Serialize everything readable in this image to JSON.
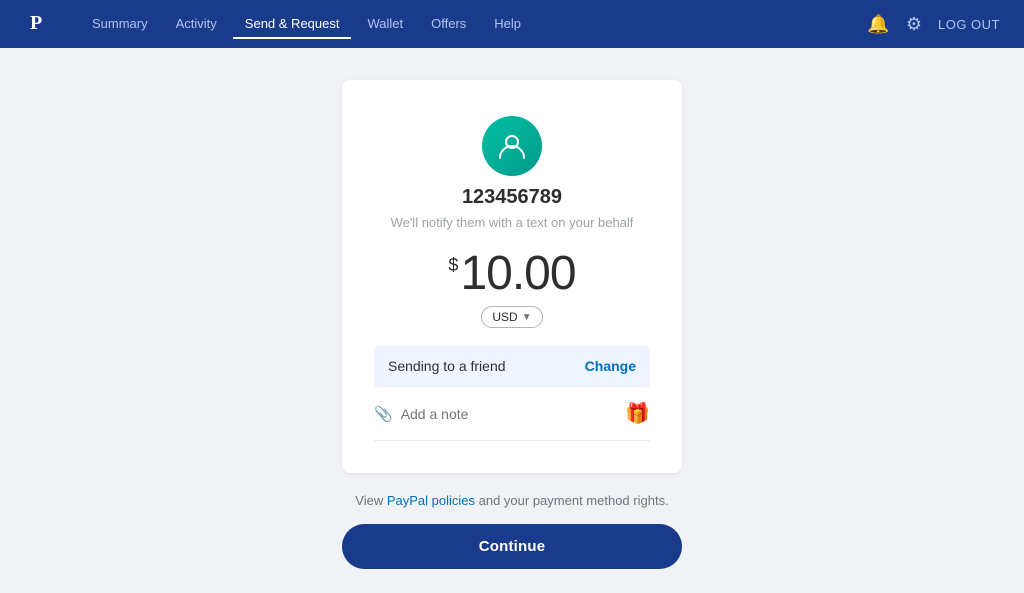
{
  "header": {
    "logo_alt": "PayPal",
    "nav": [
      {
        "id": "summary",
        "label": "Summary",
        "active": false
      },
      {
        "id": "activity",
        "label": "Activity",
        "active": false
      },
      {
        "id": "send-request",
        "label": "Send & Request",
        "active": true
      },
      {
        "id": "wallet",
        "label": "Wallet",
        "active": false
      },
      {
        "id": "offers",
        "label": "Offers",
        "active": false
      },
      {
        "id": "help",
        "label": "Help",
        "active": false
      }
    ],
    "logout_label": "LOG OUT"
  },
  "recipient": {
    "name": "123456789",
    "subtitle": "We'll notify them with a text on your behalf"
  },
  "amount": {
    "currency_symbol": "$",
    "value": "10.00",
    "currency": "USD"
  },
  "sending_row": {
    "label": "Sending to a friend",
    "change_label": "Change"
  },
  "note": {
    "placeholder": "Add a note"
  },
  "policies": {
    "prefix": "View ",
    "link_label": "PayPal policies",
    "suffix": " and your payment method rights."
  },
  "continue_button": {
    "label": "Continue"
  }
}
